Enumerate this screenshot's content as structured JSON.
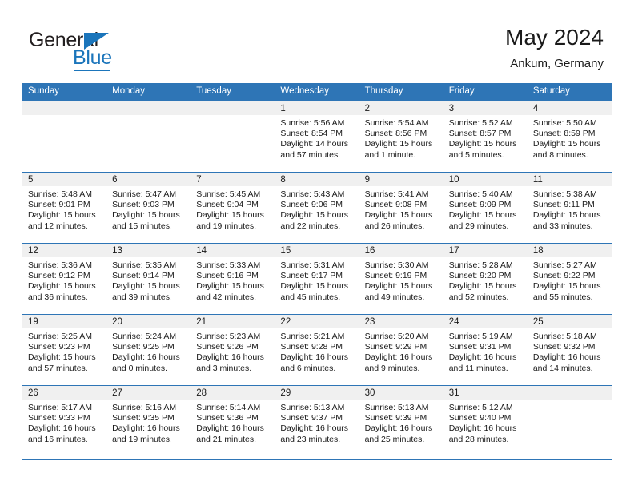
{
  "brand": {
    "name_part1": "General",
    "name_part2": "Blue"
  },
  "header": {
    "title": "May 2024",
    "subtitle": "Ankum, Germany"
  },
  "calendar": {
    "day_headers": [
      "Sunday",
      "Monday",
      "Tuesday",
      "Wednesday",
      "Thursday",
      "Friday",
      "Saturday"
    ],
    "labels": {
      "sunrise": "Sunrise:",
      "sunset": "Sunset:",
      "daylight": "Daylight:"
    },
    "colors": {
      "header_blue": "#2e75b6",
      "brand_blue": "#1b75bb",
      "daynum_strip": "#f0f0f0",
      "text": "#1a1a1a"
    },
    "weeks": [
      [
        {
          "day": "",
          "sunrise": "",
          "sunset": "",
          "daylight_line1": "",
          "daylight_line2": ""
        },
        {
          "day": "",
          "sunrise": "",
          "sunset": "",
          "daylight_line1": "",
          "daylight_line2": ""
        },
        {
          "day": "",
          "sunrise": "",
          "sunset": "",
          "daylight_line1": "",
          "daylight_line2": ""
        },
        {
          "day": "1",
          "sunrise": "Sunrise: 5:56 AM",
          "sunset": "Sunset: 8:54 PM",
          "daylight_line1": "Daylight: 14 hours",
          "daylight_line2": "and 57 minutes."
        },
        {
          "day": "2",
          "sunrise": "Sunrise: 5:54 AM",
          "sunset": "Sunset: 8:56 PM",
          "daylight_line1": "Daylight: 15 hours",
          "daylight_line2": "and 1 minute."
        },
        {
          "day": "3",
          "sunrise": "Sunrise: 5:52 AM",
          "sunset": "Sunset: 8:57 PM",
          "daylight_line1": "Daylight: 15 hours",
          "daylight_line2": "and 5 minutes."
        },
        {
          "day": "4",
          "sunrise": "Sunrise: 5:50 AM",
          "sunset": "Sunset: 8:59 PM",
          "daylight_line1": "Daylight: 15 hours",
          "daylight_line2": "and 8 minutes."
        }
      ],
      [
        {
          "day": "5",
          "sunrise": "Sunrise: 5:48 AM",
          "sunset": "Sunset: 9:01 PM",
          "daylight_line1": "Daylight: 15 hours",
          "daylight_line2": "and 12 minutes."
        },
        {
          "day": "6",
          "sunrise": "Sunrise: 5:47 AM",
          "sunset": "Sunset: 9:03 PM",
          "daylight_line1": "Daylight: 15 hours",
          "daylight_line2": "and 15 minutes."
        },
        {
          "day": "7",
          "sunrise": "Sunrise: 5:45 AM",
          "sunset": "Sunset: 9:04 PM",
          "daylight_line1": "Daylight: 15 hours",
          "daylight_line2": "and 19 minutes."
        },
        {
          "day": "8",
          "sunrise": "Sunrise: 5:43 AM",
          "sunset": "Sunset: 9:06 PM",
          "daylight_line1": "Daylight: 15 hours",
          "daylight_line2": "and 22 minutes."
        },
        {
          "day": "9",
          "sunrise": "Sunrise: 5:41 AM",
          "sunset": "Sunset: 9:08 PM",
          "daylight_line1": "Daylight: 15 hours",
          "daylight_line2": "and 26 minutes."
        },
        {
          "day": "10",
          "sunrise": "Sunrise: 5:40 AM",
          "sunset": "Sunset: 9:09 PM",
          "daylight_line1": "Daylight: 15 hours",
          "daylight_line2": "and 29 minutes."
        },
        {
          "day": "11",
          "sunrise": "Sunrise: 5:38 AM",
          "sunset": "Sunset: 9:11 PM",
          "daylight_line1": "Daylight: 15 hours",
          "daylight_line2": "and 33 minutes."
        }
      ],
      [
        {
          "day": "12",
          "sunrise": "Sunrise: 5:36 AM",
          "sunset": "Sunset: 9:12 PM",
          "daylight_line1": "Daylight: 15 hours",
          "daylight_line2": "and 36 minutes."
        },
        {
          "day": "13",
          "sunrise": "Sunrise: 5:35 AM",
          "sunset": "Sunset: 9:14 PM",
          "daylight_line1": "Daylight: 15 hours",
          "daylight_line2": "and 39 minutes."
        },
        {
          "day": "14",
          "sunrise": "Sunrise: 5:33 AM",
          "sunset": "Sunset: 9:16 PM",
          "daylight_line1": "Daylight: 15 hours",
          "daylight_line2": "and 42 minutes."
        },
        {
          "day": "15",
          "sunrise": "Sunrise: 5:31 AM",
          "sunset": "Sunset: 9:17 PM",
          "daylight_line1": "Daylight: 15 hours",
          "daylight_line2": "and 45 minutes."
        },
        {
          "day": "16",
          "sunrise": "Sunrise: 5:30 AM",
          "sunset": "Sunset: 9:19 PM",
          "daylight_line1": "Daylight: 15 hours",
          "daylight_line2": "and 49 minutes."
        },
        {
          "day": "17",
          "sunrise": "Sunrise: 5:28 AM",
          "sunset": "Sunset: 9:20 PM",
          "daylight_line1": "Daylight: 15 hours",
          "daylight_line2": "and 52 minutes."
        },
        {
          "day": "18",
          "sunrise": "Sunrise: 5:27 AM",
          "sunset": "Sunset: 9:22 PM",
          "daylight_line1": "Daylight: 15 hours",
          "daylight_line2": "and 55 minutes."
        }
      ],
      [
        {
          "day": "19",
          "sunrise": "Sunrise: 5:25 AM",
          "sunset": "Sunset: 9:23 PM",
          "daylight_line1": "Daylight: 15 hours",
          "daylight_line2": "and 57 minutes."
        },
        {
          "day": "20",
          "sunrise": "Sunrise: 5:24 AM",
          "sunset": "Sunset: 9:25 PM",
          "daylight_line1": "Daylight: 16 hours",
          "daylight_line2": "and 0 minutes."
        },
        {
          "day": "21",
          "sunrise": "Sunrise: 5:23 AM",
          "sunset": "Sunset: 9:26 PM",
          "daylight_line1": "Daylight: 16 hours",
          "daylight_line2": "and 3 minutes."
        },
        {
          "day": "22",
          "sunrise": "Sunrise: 5:21 AM",
          "sunset": "Sunset: 9:28 PM",
          "daylight_line1": "Daylight: 16 hours",
          "daylight_line2": "and 6 minutes."
        },
        {
          "day": "23",
          "sunrise": "Sunrise: 5:20 AM",
          "sunset": "Sunset: 9:29 PM",
          "daylight_line1": "Daylight: 16 hours",
          "daylight_line2": "and 9 minutes."
        },
        {
          "day": "24",
          "sunrise": "Sunrise: 5:19 AM",
          "sunset": "Sunset: 9:31 PM",
          "daylight_line1": "Daylight: 16 hours",
          "daylight_line2": "and 11 minutes."
        },
        {
          "day": "25",
          "sunrise": "Sunrise: 5:18 AM",
          "sunset": "Sunset: 9:32 PM",
          "daylight_line1": "Daylight: 16 hours",
          "daylight_line2": "and 14 minutes."
        }
      ],
      [
        {
          "day": "26",
          "sunrise": "Sunrise: 5:17 AM",
          "sunset": "Sunset: 9:33 PM",
          "daylight_line1": "Daylight: 16 hours",
          "daylight_line2": "and 16 minutes."
        },
        {
          "day": "27",
          "sunrise": "Sunrise: 5:16 AM",
          "sunset": "Sunset: 9:35 PM",
          "daylight_line1": "Daylight: 16 hours",
          "daylight_line2": "and 19 minutes."
        },
        {
          "day": "28",
          "sunrise": "Sunrise: 5:14 AM",
          "sunset": "Sunset: 9:36 PM",
          "daylight_line1": "Daylight: 16 hours",
          "daylight_line2": "and 21 minutes."
        },
        {
          "day": "29",
          "sunrise": "Sunrise: 5:13 AM",
          "sunset": "Sunset: 9:37 PM",
          "daylight_line1": "Daylight: 16 hours",
          "daylight_line2": "and 23 minutes."
        },
        {
          "day": "30",
          "sunrise": "Sunrise: 5:13 AM",
          "sunset": "Sunset: 9:39 PM",
          "daylight_line1": "Daylight: 16 hours",
          "daylight_line2": "and 25 minutes."
        },
        {
          "day": "31",
          "sunrise": "Sunrise: 5:12 AM",
          "sunset": "Sunset: 9:40 PM",
          "daylight_line1": "Daylight: 16 hours",
          "daylight_line2": "and 28 minutes."
        },
        {
          "day": "",
          "sunrise": "",
          "sunset": "",
          "daylight_line1": "",
          "daylight_line2": ""
        }
      ]
    ]
  }
}
